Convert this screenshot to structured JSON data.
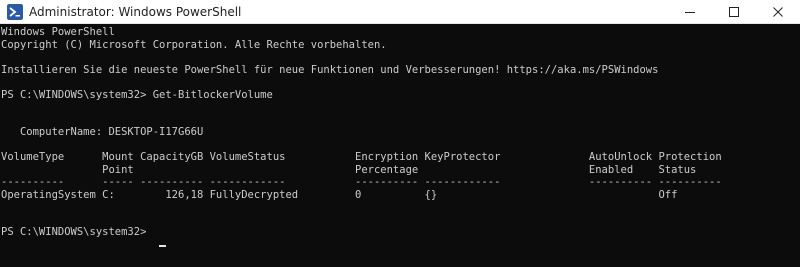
{
  "window": {
    "title": "Administrator: Windows PowerShell",
    "icon_name": "powershell-icon",
    "controls": {
      "minimize_icon": "minimize-icon",
      "maximize_icon": "maximize-icon",
      "close_icon": "close-icon"
    }
  },
  "terminal": {
    "text": "Windows PowerShell\nCopyright (C) Microsoft Corporation. Alle Rechte vorbehalten.\n\nInstallieren Sie die neueste PowerShell für neue Funktionen und Verbesserungen! https://aka.ms/PSWindows\n\nPS C:\\WINDOWS\\system32> Get-BitlockerVolume\n\n\n   ComputerName: DESKTOP-I17G66U\n\nVolumeType      Mount CapacityGB VolumeStatus           Encryption KeyProtector              AutoUnlock Protection\n                Point                                   Percentage                           Enabled    Status\n----------      ----- ---------- ------------           ---------- ------------              ---------- ----------\nOperatingSystem C:        126,18 FullyDecrypted         0          {}                                   Off\n\n\nPS C:\\WINDOWS\\system32> "
  },
  "colors": {
    "terminal_background": "#0c0c0c",
    "terminal_text": "#cccccc",
    "titlebar_background": "#ffffff",
    "titlebar_text": "#1f1f1f",
    "icon_blue": "#2a5aa6"
  }
}
